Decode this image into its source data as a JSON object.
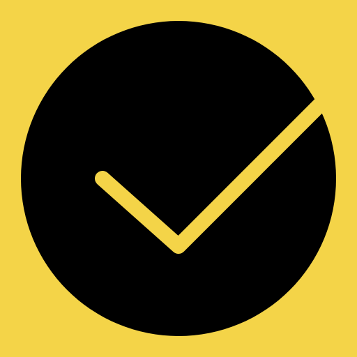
{
  "icon": {
    "name": "circle-check-icon",
    "background_color": "#F4D448",
    "circle_color": "#000000",
    "check_color": "#F4D448"
  }
}
